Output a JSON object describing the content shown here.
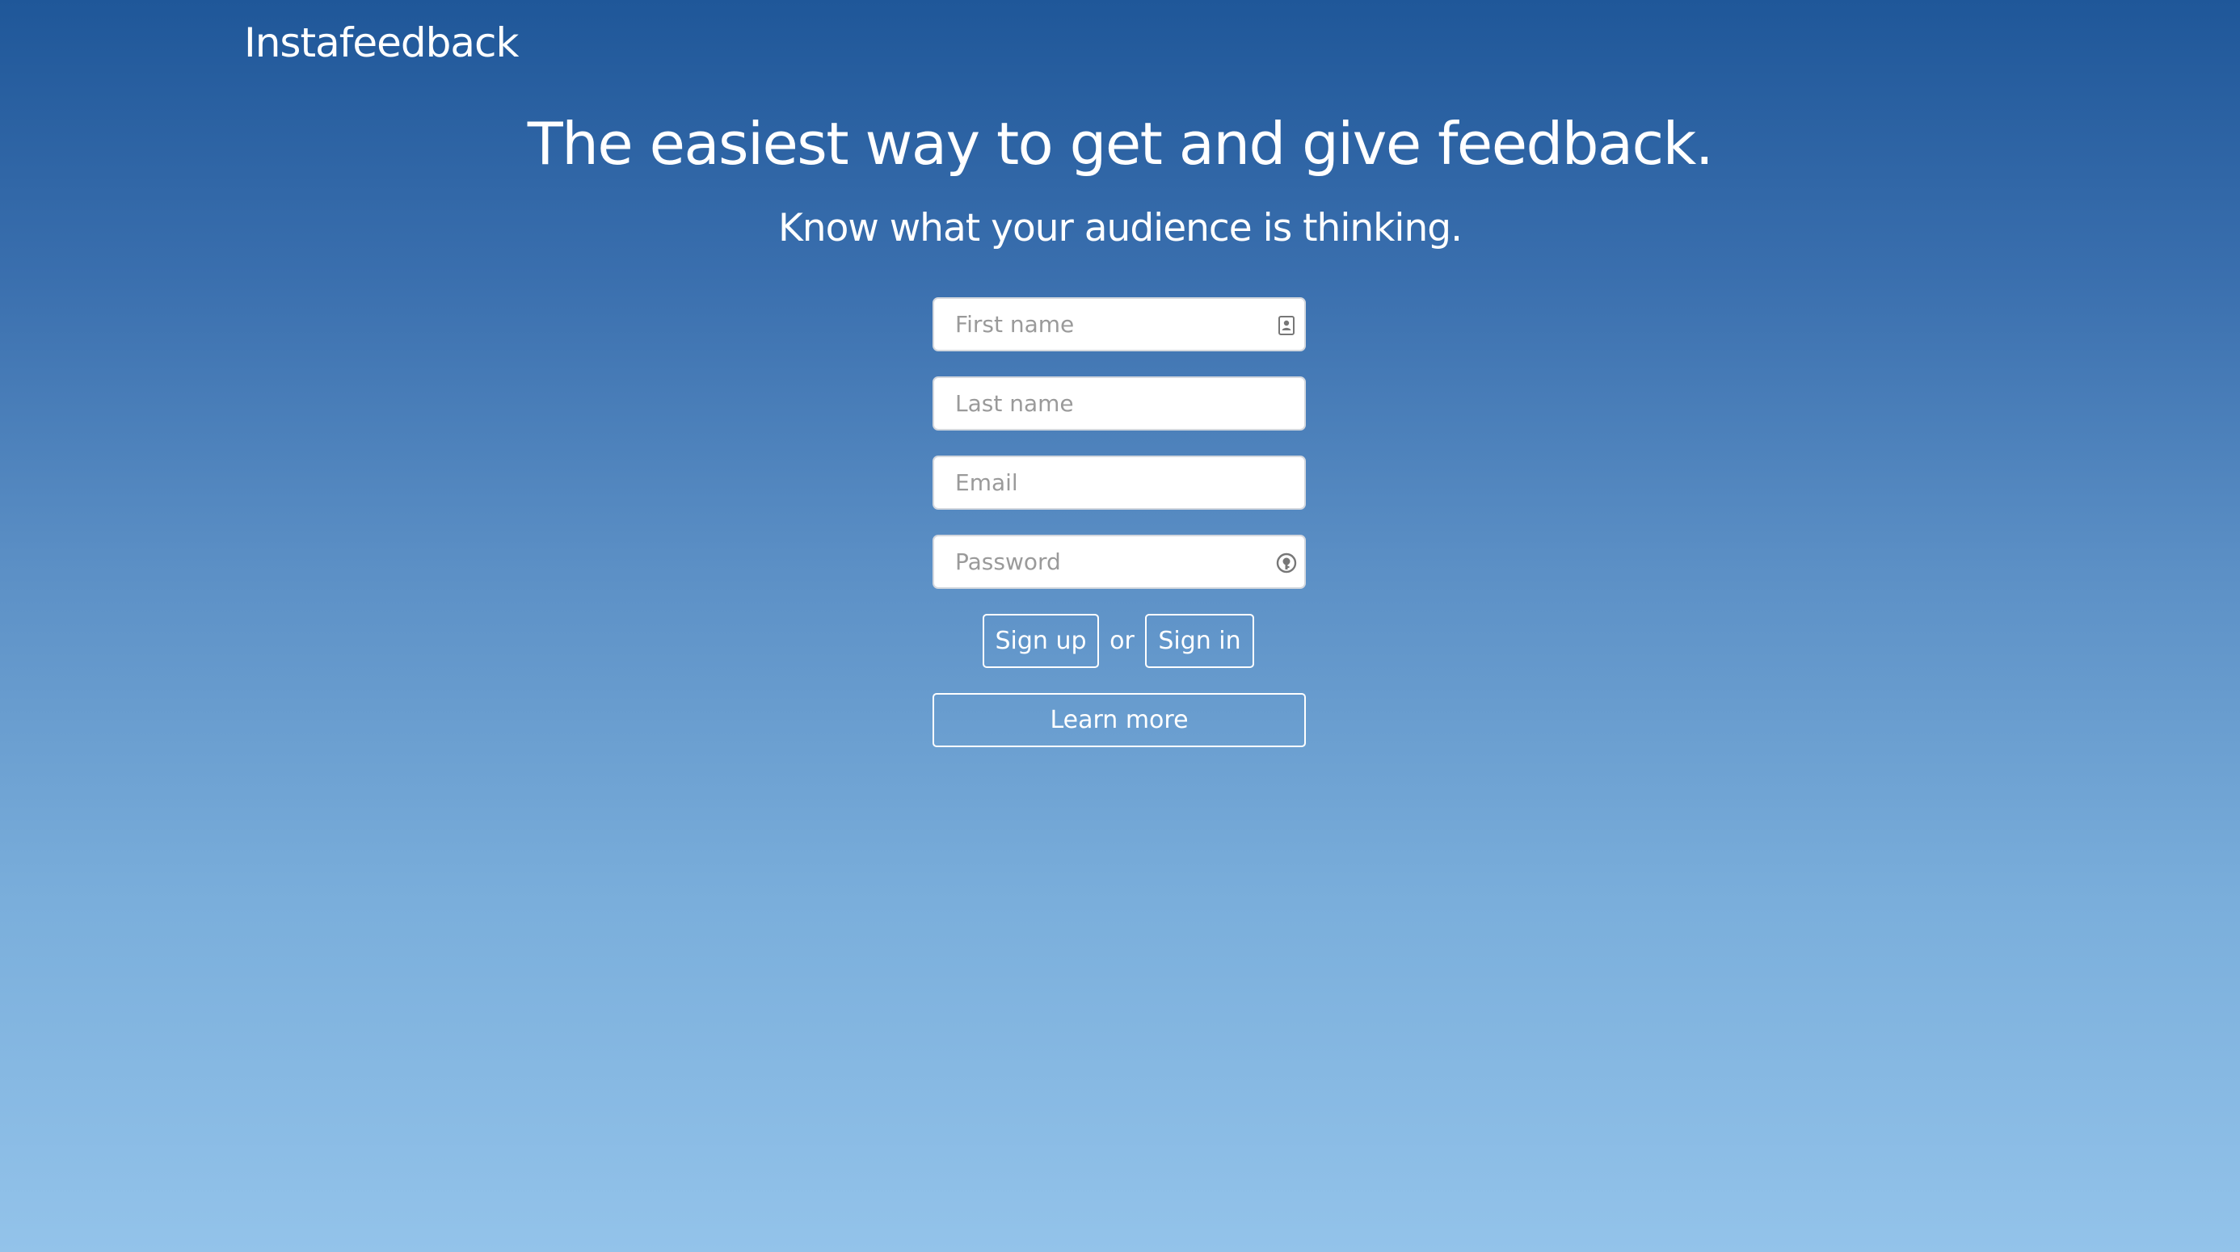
{
  "brand": {
    "name": "Instafeedback"
  },
  "hero": {
    "title": "The easiest way to get and give feedback.",
    "subtitle": "Know what your audience is thinking."
  },
  "form": {
    "first_name_placeholder": "First name",
    "last_name_placeholder": "Last name",
    "email_placeholder": "Email",
    "password_placeholder": "Password",
    "first_name_value": "",
    "last_name_value": "",
    "email_value": "",
    "password_value": "",
    "first_name_icon": "contact-card-icon",
    "password_icon": "password-key-icon"
  },
  "actions": {
    "sign_up_label": "Sign up",
    "or_label": "or",
    "sign_in_label": "Sign in",
    "learn_more_label": "Learn more"
  },
  "colors": {
    "background_top": "#1f5799",
    "background_bottom": "#93c3ea",
    "text": "#ffffff",
    "input_border": "#d4d8de",
    "placeholder": "#9a9a9a"
  }
}
